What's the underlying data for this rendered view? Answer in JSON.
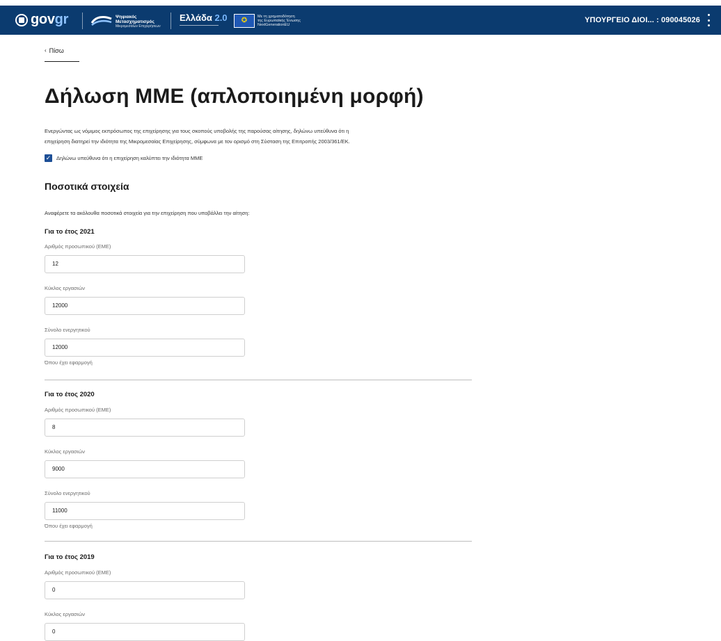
{
  "header": {
    "logo_text_gov": "gov",
    "logo_text_gr": "gr",
    "digital_transformation_line1": "Ψηφιακός",
    "digital_transformation_line2": "Μετασχηματισμός",
    "digital_transformation_sub": "Μικρομεσαίων Επιχειρήσεων",
    "ellada_text": "Ελλάδα",
    "ellada_version": "2.0",
    "eu_text_line1": "Με τη χρηματοδότηση",
    "eu_text_line2": "της Ευρωπαϊκής Ένωσης",
    "eu_text_line3": "NextGenerationEU",
    "account": "ΥΠΟΥΡΓΕΙΟ ΔΙΟΙ... : 090045026"
  },
  "back_link": "Πίσω",
  "page_title": "Δήλωση ΜΜΕ (απλοποιημένη μορφή)",
  "intro_line1": "Ενεργώντας ως νόμιμος εκπρόσωπος της επιχείρησης για τους σκοπούς υποβολής της παρούσας αίτησης, δηλώνω υπεύθυνα ότι η",
  "intro_line2": "επιχείρηση διατηρεί την ιδιότητα της Μικρομεσαίας Επιχείρησης, σύμφωνα με τον ορισμό στη Σύσταση της Επιτροπής 2003/361/ΕΚ.",
  "checkbox_label": "Δηλώνω υπεύθυνα ότι η επιχείρηση καλύπτει την ιδιότητα ΜΜΕ",
  "checkbox_checked": true,
  "section_title": "Ποσοτικά στοιχεία",
  "section_desc": "Αναφέρετε τα ακόλουθα ποσοτικά στοιχεία για την επιχείρηση που υποβάλλει την αίτηση:",
  "labels": {
    "staff": "Αριθμός προσωπικού (ΕΜΕ)",
    "turnover": "Κύκλος εργασιών",
    "assets": "Σύνολο ενεργητικού",
    "hint": "Όπου έχει εφαρμογή"
  },
  "years": [
    {
      "title": "Για το έτος 2021",
      "staff": "12",
      "turnover": "12000",
      "assets": "12000"
    },
    {
      "title": "Για το έτος 2020",
      "staff": "8",
      "turnover": "9000",
      "assets": "11000"
    },
    {
      "title": "Για το έτος 2019",
      "staff": "0",
      "turnover": "0"
    }
  ],
  "colors": {
    "header_bg": "#0b3b6f",
    "checkbox": "#1d4f96"
  }
}
